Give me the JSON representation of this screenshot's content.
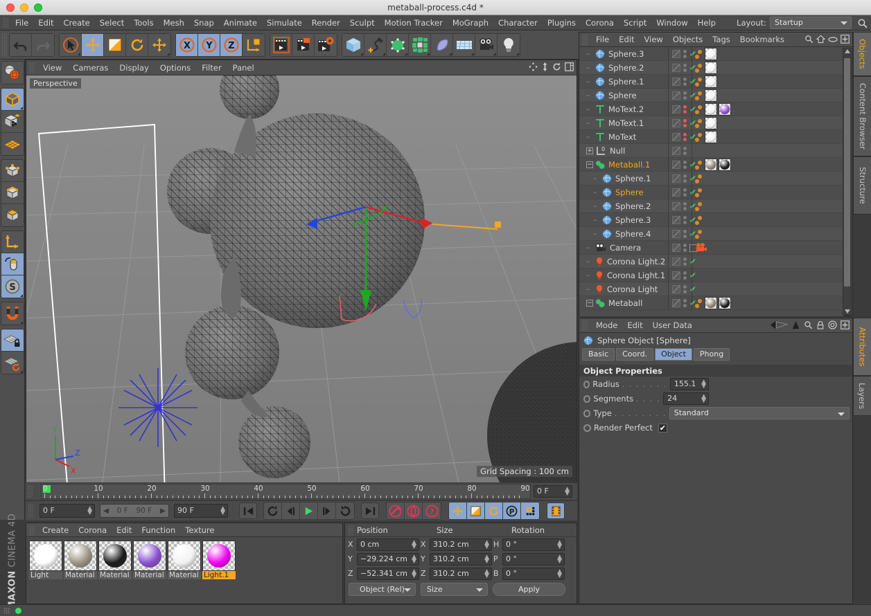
{
  "window": {
    "title": "metaball-process.c4d *"
  },
  "menubar": {
    "items": [
      "File",
      "Edit",
      "Create",
      "Select",
      "Tools",
      "Mesh",
      "Snap",
      "Animate",
      "Simulate",
      "Render",
      "Sculpt",
      "Motion Tracker",
      "MoGraph",
      "Character",
      "Plugins",
      "Corona",
      "Script",
      "Window",
      "Help"
    ],
    "layout_label": "Layout:",
    "layout_value": "Startup"
  },
  "viewport": {
    "menu": [
      "View",
      "Cameras",
      "Display",
      "Options",
      "Filter",
      "Panel"
    ],
    "perspective_badge": "Perspective",
    "grid_spacing": "Grid Spacing : 100 cm",
    "axis_labels": {
      "x": "X",
      "y": "Y",
      "z": "Z"
    }
  },
  "timeline": {
    "ticks": [
      "0",
      "10",
      "20",
      "30",
      "40",
      "50",
      "60",
      "70",
      "80",
      "90"
    ],
    "current_frame_right": "0 F",
    "current_frame": "0 F",
    "range_start": "0 F",
    "range_end": "90 F",
    "max_frame": "90 F"
  },
  "material_manager": {
    "menu": [
      "Create",
      "Corona",
      "Edit",
      "Function",
      "Texture"
    ],
    "materials": [
      {
        "name": "Light",
        "color": "#ffffff",
        "selected": false
      },
      {
        "name": "Material",
        "color": "#9b9381",
        "selected": false
      },
      {
        "name": "Material",
        "color": "#1b1b1b",
        "selected": false
      },
      {
        "name": "Material",
        "color": "#8a4fd0",
        "selected": false
      },
      {
        "name": "Material",
        "color": "#f2f2f2",
        "selected": false
      },
      {
        "name": "Light.1",
        "color": "#ef00ef",
        "selected": true
      }
    ]
  },
  "coordinates": {
    "headers": [
      "Position",
      "Size",
      "Rotation"
    ],
    "rows": [
      {
        "plabel": "X",
        "pvalue": "0 cm",
        "slabel": "X",
        "svalue": "310.2 cm",
        "rlabel": "H",
        "rvalue": "0 °"
      },
      {
        "plabel": "Y",
        "pvalue": "−29.224 cm",
        "slabel": "Y",
        "svalue": "310.2 cm",
        "rlabel": "P",
        "rvalue": "0 °"
      },
      {
        "plabel": "Z",
        "pvalue": "−52.341 cm",
        "slabel": "Z",
        "svalue": "310.2 cm",
        "rlabel": "B",
        "rvalue": "0 °"
      }
    ],
    "mode_select": "Object (Rel)",
    "size_select": "Size",
    "apply_button": "Apply"
  },
  "object_manager": {
    "menu": [
      "File",
      "Edit",
      "View",
      "Objects",
      "Tags",
      "Bookmarks"
    ],
    "rows": [
      {
        "name": "Sphere.3",
        "icon": "sphere",
        "indent": 1,
        "selected": false,
        "dots": "gray",
        "check": true,
        "tags": [
          "checker",
          "white-ball"
        ]
      },
      {
        "name": "Sphere.2",
        "icon": "sphere",
        "indent": 1,
        "selected": false,
        "dots": "gray",
        "check": true,
        "tags": [
          "checker",
          "white-ball"
        ]
      },
      {
        "name": "Sphere.1",
        "icon": "sphere",
        "indent": 1,
        "selected": false,
        "dots": "gray",
        "check": true,
        "tags": [
          "checker",
          "white-ball"
        ]
      },
      {
        "name": "Sphere",
        "icon": "sphere",
        "indent": 1,
        "selected": false,
        "dots": "gray",
        "check": true,
        "tags": [
          "checker",
          "white-ball"
        ]
      },
      {
        "name": "MoText.2",
        "icon": "motext",
        "indent": 1,
        "selected": false,
        "dots": "red",
        "check": true,
        "tags": [
          "checker",
          "white-ball",
          "purple-ball"
        ]
      },
      {
        "name": "MoText.1",
        "icon": "motext",
        "indent": 1,
        "selected": false,
        "dots": "red",
        "check": true,
        "tags": [
          "checker",
          "white-ball"
        ]
      },
      {
        "name": "MoText",
        "icon": "motext",
        "indent": 1,
        "selected": false,
        "dots": "red",
        "check": true,
        "tags": [
          "checker",
          "white-ball"
        ]
      },
      {
        "name": "Null",
        "icon": "null",
        "indent": 1,
        "selected": false,
        "dots": "gray",
        "check": false,
        "tags": []
      },
      {
        "name": "Metaball.1",
        "icon": "metaball",
        "indent": 1,
        "selected": true,
        "dots": "gray",
        "check": true,
        "tags": [
          "checker",
          "gray-ball",
          "black-ball"
        ]
      },
      {
        "name": "Sphere.1",
        "icon": "sphere",
        "indent": 2,
        "selected": false,
        "dots": "gray",
        "check": true,
        "tags": [
          "checker"
        ]
      },
      {
        "name": "Sphere",
        "icon": "sphere",
        "indent": 2,
        "selected": true,
        "dots": "gray",
        "check": true,
        "tags": [
          "checker"
        ]
      },
      {
        "name": "Sphere.2",
        "icon": "sphere",
        "indent": 2,
        "selected": false,
        "dots": "gray",
        "check": true,
        "tags": [
          "checker"
        ]
      },
      {
        "name": "Sphere.3",
        "icon": "sphere",
        "indent": 2,
        "selected": false,
        "dots": "gray",
        "check": true,
        "tags": [
          "checker"
        ]
      },
      {
        "name": "Sphere.4",
        "icon": "sphere",
        "indent": 2,
        "selected": false,
        "dots": "gray",
        "check": true,
        "tags": [
          "checker"
        ]
      },
      {
        "name": "Camera",
        "icon": "camera",
        "indent": 1,
        "selected": false,
        "dots": "gray",
        "check": false,
        "tags": [
          "camera-tag"
        ]
      },
      {
        "name": "Corona Light.2",
        "icon": "light",
        "indent": 1,
        "selected": false,
        "dots": "gray",
        "check": true,
        "tags": []
      },
      {
        "name": "Corona Light.1",
        "icon": "light",
        "indent": 1,
        "selected": false,
        "dots": "gray",
        "check": true,
        "tags": []
      },
      {
        "name": "Corona Light",
        "icon": "light",
        "indent": 1,
        "selected": false,
        "dots": "gray",
        "check": true,
        "tags": []
      },
      {
        "name": "Metaball",
        "icon": "metaball",
        "indent": 1,
        "selected": false,
        "dots": "gray",
        "check": true,
        "tags": [
          "checker",
          "gray-ball",
          "black-ball"
        ]
      }
    ]
  },
  "attribute_manager": {
    "menu": [
      "Mode",
      "Edit",
      "User Data"
    ],
    "object_title": "Sphere Object [Sphere]",
    "tabs": [
      {
        "label": "Basic",
        "selected": false
      },
      {
        "label": "Coord.",
        "selected": false
      },
      {
        "label": "Object",
        "selected": true
      },
      {
        "label": "Phong",
        "selected": false
      }
    ],
    "section_title": "Object Properties",
    "properties": [
      {
        "label": "Radius",
        "dots": ". . . . . . .",
        "value": "155.1 cm",
        "kind": "field"
      },
      {
        "label": "Segments",
        "dots": ". . . .",
        "value": "24",
        "kind": "field"
      },
      {
        "label": "Type",
        "dots": ". . . . . . . .",
        "value": "Standard",
        "kind": "dropdown"
      },
      {
        "label": "Render Perfect",
        "dots": "",
        "value": "✔",
        "kind": "checkbox"
      }
    ]
  },
  "right_tabs_top": [
    {
      "label": "Objects",
      "selected": true
    },
    {
      "label": "Content Browser",
      "selected": false
    },
    {
      "label": "Structure",
      "selected": false
    }
  ],
  "right_tabs_bottom": [
    {
      "label": "Attributes",
      "selected": true
    },
    {
      "label": "Layers",
      "selected": false
    }
  ],
  "brand": {
    "maxon": "MAXON",
    "c4d": "CINEMA 4D"
  },
  "colors": {
    "accent": "#f5a623",
    "selection": "#8aa6d0",
    "check": "#4fd06a",
    "tag": "#d98a2b"
  }
}
